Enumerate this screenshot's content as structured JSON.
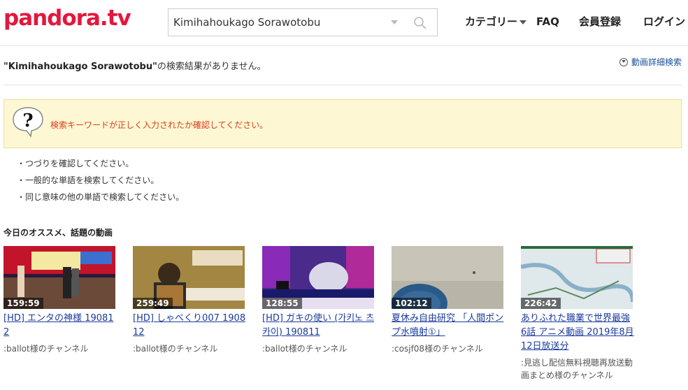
{
  "header": {
    "logo": "pandora.tv",
    "search_value": "Kimihahoukago Sorawotobu",
    "nav": [
      "カテゴリー",
      "FAQ",
      "会員登録",
      "ログイン"
    ]
  },
  "result": {
    "query": "\"Kimihahoukago Sorawotobu\"",
    "message": "の検索結果がありません。",
    "advanced_search": "動画詳細検索"
  },
  "notice": {
    "text": "検索キーワードが正しく入力されたか確認してください。"
  },
  "tips": [
    "・つづりを確認してください。",
    "・一般的な単語を検索してください。",
    "・同じ意味の他の単語で検索してください。"
  ],
  "section_title": "今日のオススメ、話題の動画",
  "videos": [
    {
      "duration": "159:59",
      "title": "[HD] エンタの神様 190812",
      "channel": ":ballot様のチャンネル"
    },
    {
      "duration": "259:49",
      "title": "[HD] しゃべくり007 190812",
      "channel": ":ballot様のチャンネル"
    },
    {
      "duration": "128:55",
      "title": "[HD] ガキの使い (가키노 츠카이) 190811",
      "channel": ":ballot様のチャンネル"
    },
    {
      "duration": "102:12",
      "title": "夏休み自由研究 「人間ポンプ水噴射①」",
      "channel": ":cosjf08様のチャンネル"
    },
    {
      "duration": "226:42",
      "title": "ありふれた職業で世界最強 6話 アニメ動画 2019年8月12日放送分",
      "channel": ":見逃し配信無料視聴再放送動画まとめ様のチャンネル"
    }
  ],
  "colors": {
    "brand": "#e3173d",
    "link": "#1a3a9e",
    "notice_bg": "#fdf8d3",
    "notice_text": "#e03a1e"
  }
}
